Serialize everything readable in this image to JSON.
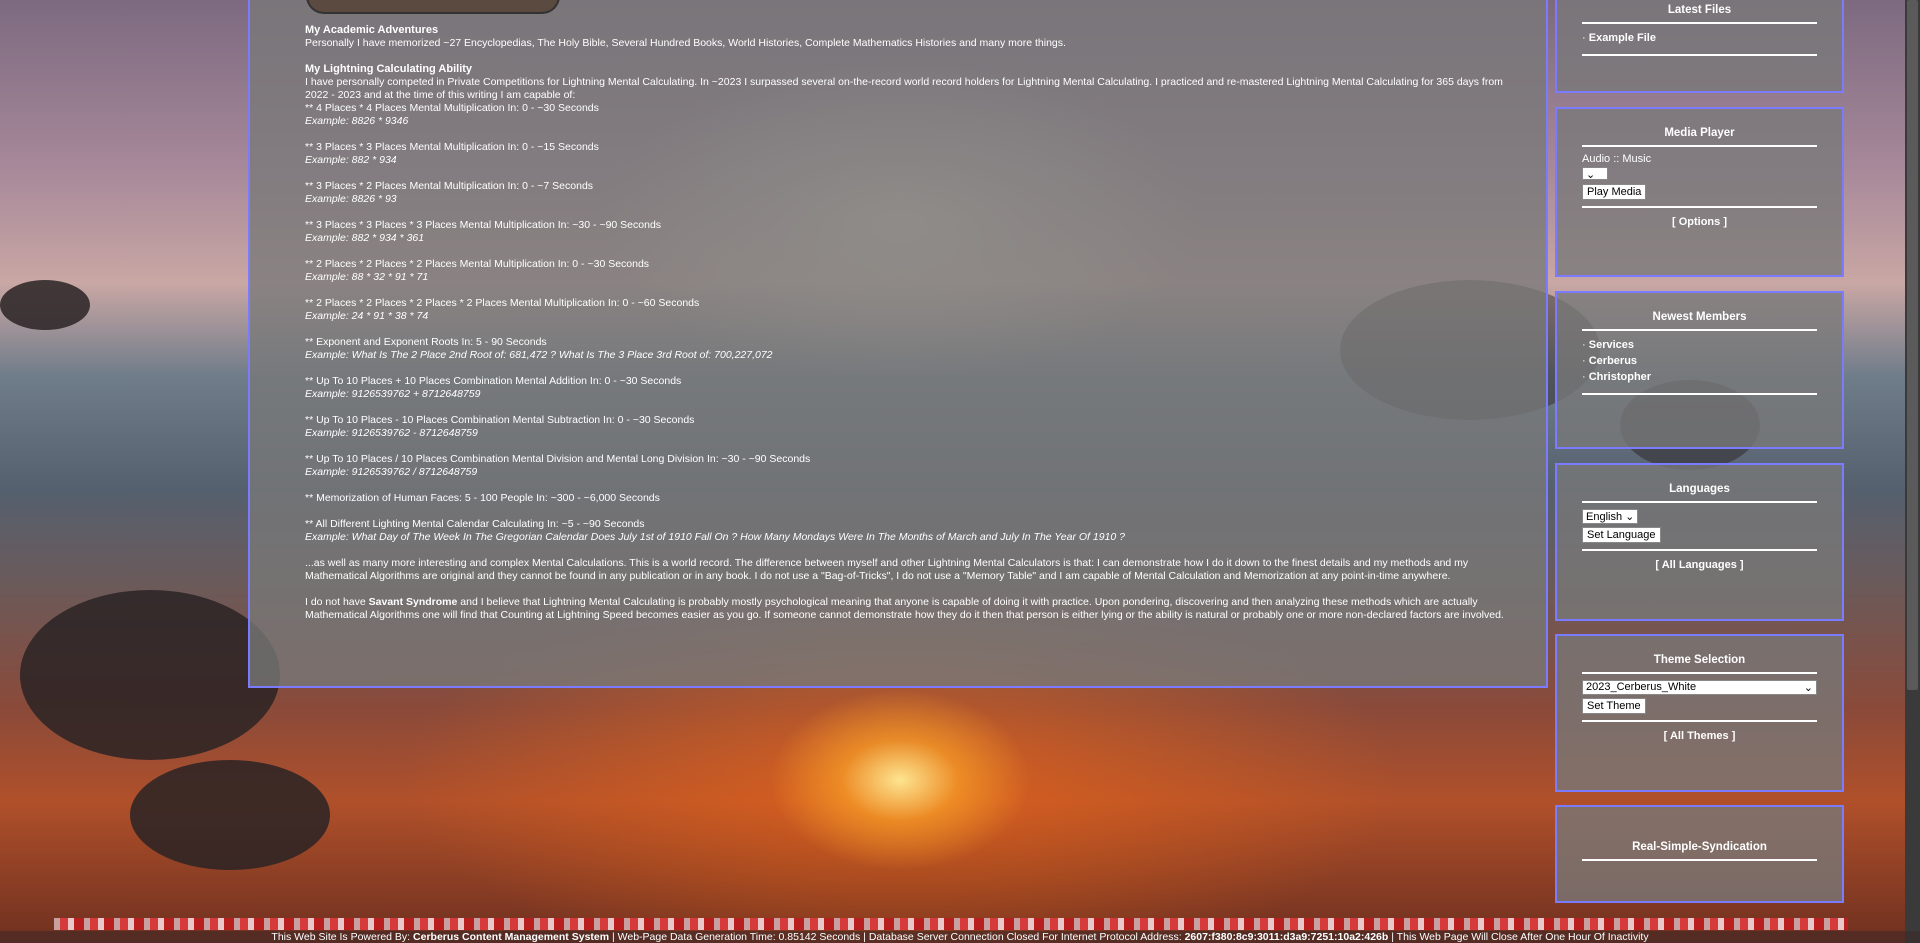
{
  "main": {
    "sections": [
      {
        "heading": "My Academic Adventures",
        "body": "Personally I have memorized ~27 Encyclopedias, The Holy Bible, Several Hundred Books, World Histories, Complete Mathematics Histories and many more things."
      },
      {
        "heading": "My Lightning Calculating Ability",
        "intro": "I have personally competed in Private Competitions for Lightning Mental Calculating. In ~2023 I surpassed several on-the-record world record holders for Lightning Mental Calculating. I practiced and re-mastered Lightning Mental Calculating for 365 days from 2022 - 2023 and at the time of this writing I am capable of:"
      }
    ],
    "abilities": [
      {
        "text": "** 4 Places * 4 Places Mental Multiplication In: 0 - ~30 Seconds",
        "example": "Example: 8826 * 9346"
      },
      {
        "text": "** 3 Places * 3 Places Mental Multiplication In: 0 - ~15 Seconds",
        "example": "Example: 882 * 934"
      },
      {
        "text": "** 3 Places * 2 Places Mental Multiplication In: 0 - ~7 Seconds",
        "example": "Example: 8826 * 93"
      },
      {
        "text": "** 3 Places * 3 Places * 3 Places Mental Multiplication In: ~30 - ~90 Seconds",
        "example": "Example: 882 * 934 * 361"
      },
      {
        "text": "** 2 Places * 2 Places * 2 Places Mental Multiplication In: 0 - ~30 Seconds",
        "example": "Example: 88 * 32 * 91 * 71"
      },
      {
        "text": "** 2 Places * 2 Places * 2 Places * 2 Places Mental Multiplication In: 0 - ~60 Seconds",
        "example": "Example: 24 * 91 * 38 * 74"
      },
      {
        "text": "** Exponent and Exponent Roots In: 5 - 90 Seconds",
        "example": "Example: What Is The 2 Place 2nd Root of: 681,472 ? What Is The 3 Place 3rd Root of: 700,227,072"
      },
      {
        "text": "** Up To 10 Places + 10 Places Combination Mental Addition In: 0 - ~30 Seconds",
        "example": "Example: 9126539762 + 8712648759"
      },
      {
        "text": "** Up To 10 Places - 10 Places Combination Mental Subtraction In: 0 - ~30 Seconds",
        "example": "Example: 9126539762 - 8712648759"
      },
      {
        "text": "** Up To 10 Places / 10 Places Combination Mental Division and Mental Long Division In: ~30 - ~90 Seconds",
        "example": "Example: 9126539762 / 8712648759"
      },
      {
        "text": "** Memorization of Human Faces: 5 - 100 People In: ~300 - ~6,000 Seconds",
        "example": ""
      },
      {
        "text": "** All Different Lighting Mental Calendar Calculating In: ~5 - ~90 Seconds",
        "example": "Example: What Day of The Week In The Gregorian Calendar Does July 1st of 1910 Fall On ? How Many Mondays Were In The Months of March and July In The Year Of 1910 ?"
      }
    ],
    "closing": "...as well as many more interesting and complex Mental Calculations. This is a world record. The difference between myself and other Lightning Mental Calculators is that: I can demonstrate how I do it down to the finest details and my methods and my Mathematical Algorithms are original and they cannot be found in any publication or in any book. I do not use a \"Bag-of-Tricks\", I do not use a \"Memory Table\" and I am capable of Mental Calculation and Memorization at any point-in-time anywhere.",
    "savant_pre": "I do not have ",
    "savant_bold": "Savant Syndrome",
    "savant_post": " and I believe that Lightning Mental Calculating is probably mostly psychological meaning that anyone is capable of doing it with practice. Upon pondering, discovering and then analyzing these methods which are actually Mathematical Algorithms one will find that Counting at Lightning Speed becomes easier as you go. If someone cannot demonstrate how they do it then that person is either lying or the ability is natural or probably one or more non-declared factors are involved."
  },
  "sidebar": {
    "latest_files": {
      "title": "Latest Files",
      "items": [
        "Example File"
      ]
    },
    "media_player": {
      "title": "Media Player",
      "label": "Audio :: Music",
      "select_value": "",
      "button": "Play Media",
      "link": "[ Options ]"
    },
    "newest_members": {
      "title": "Newest Members",
      "items": [
        "Services",
        "Cerberus",
        "Christopher"
      ]
    },
    "languages": {
      "title": "Languages",
      "select_value": "English",
      "button": "Set Language",
      "link": "[ All Languages ]"
    },
    "theme": {
      "title": "Theme Selection",
      "select_value": "2023_Cerberus_White",
      "button": "Set Theme",
      "link": "[ All Themes ]"
    },
    "rss": {
      "title": "Real-Simple-Syndication"
    }
  },
  "footer": {
    "pre": "This Web Site Is Powered By: ",
    "cms": "Cerberus Content Management System",
    "mid": " | Web-Page Data Generation Time: 0.85142 Seconds | Database Server Connection Closed For Internet Protocol Address: ",
    "ip": "2607:f380:8c9:3011:d3a9:7251:10a2:426b",
    "post": " |  This Web Page Will Close After One Hour Of Inactivity"
  }
}
